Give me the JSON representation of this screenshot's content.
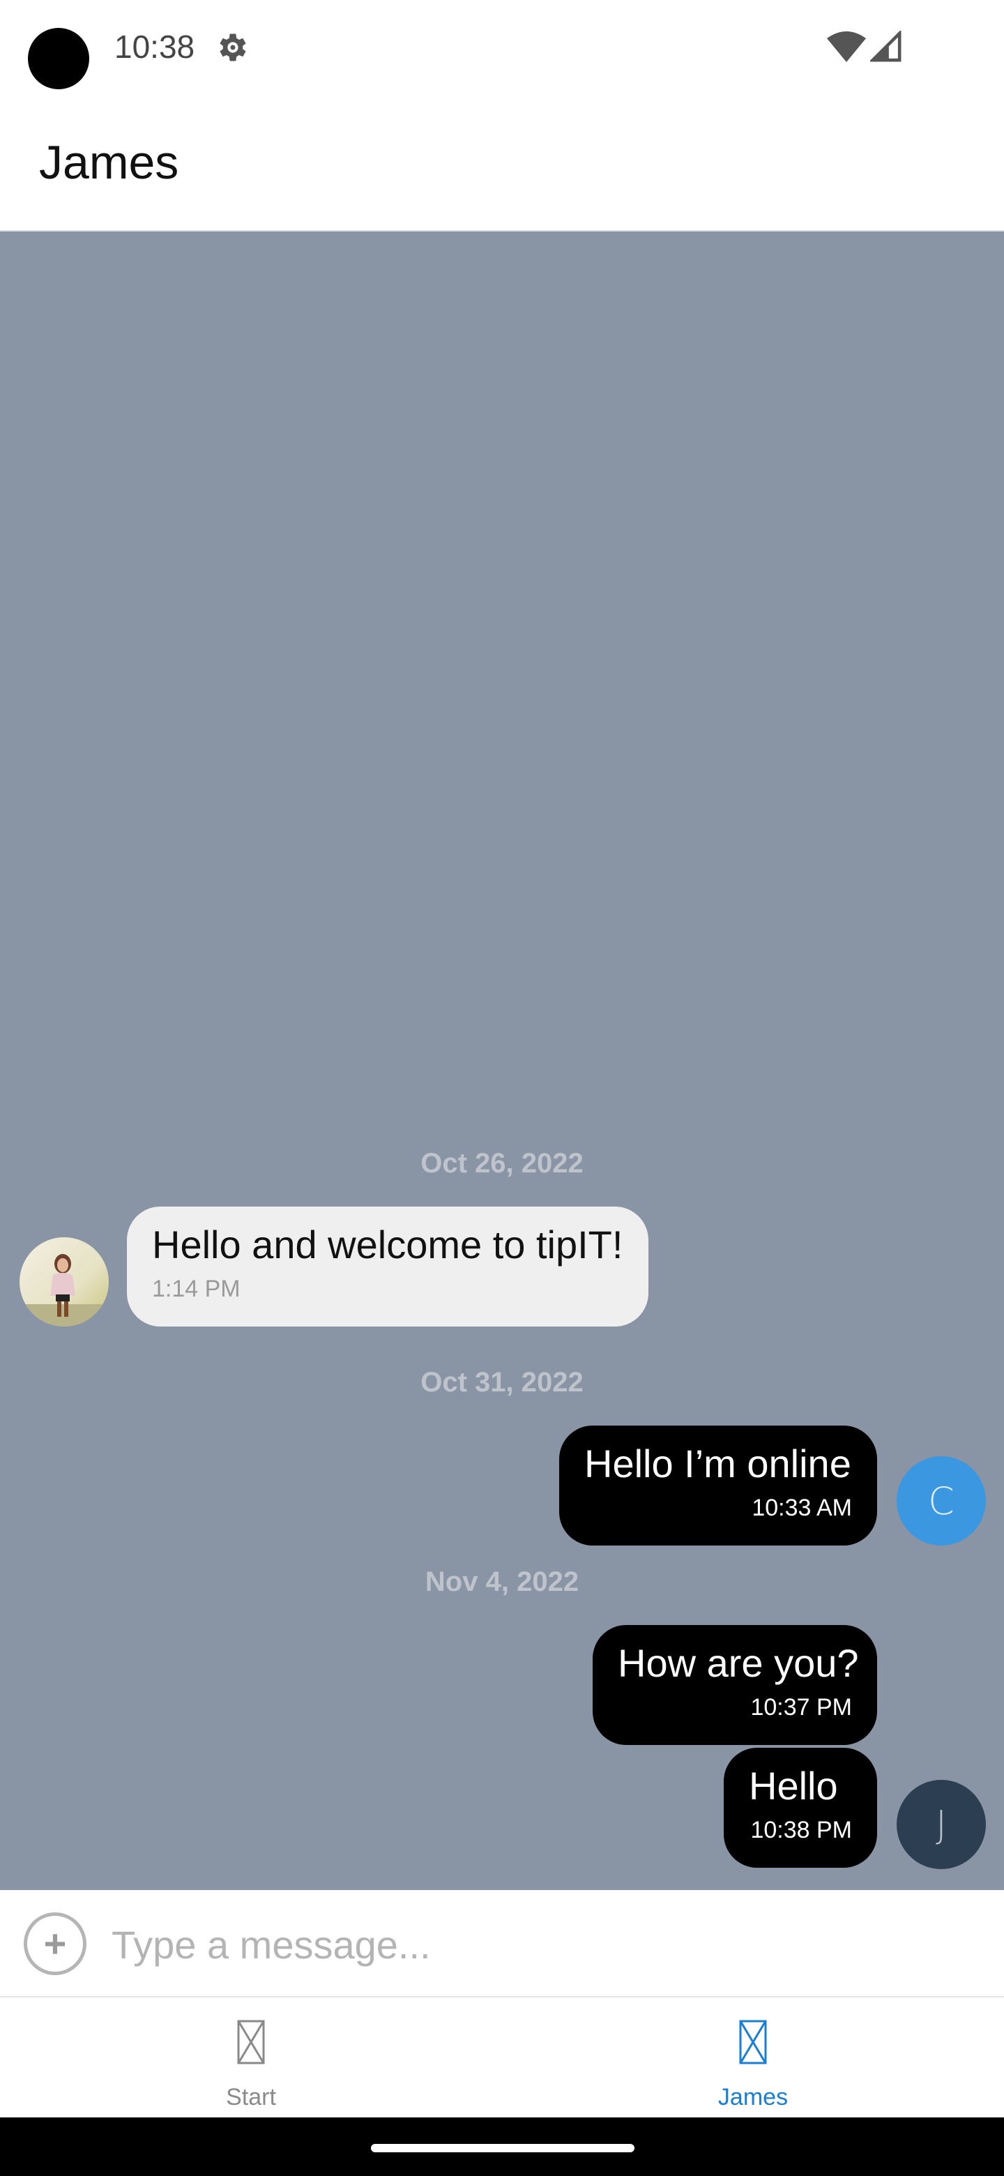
{
  "status_bar": {
    "time": "10:38",
    "icons": [
      "settings-icon",
      "wifi-icon",
      "signal-icon"
    ]
  },
  "header": {
    "title": "James"
  },
  "chat": {
    "background": "#8995a5",
    "date_1": "Oct 26, 2022",
    "msg_1": {
      "text": "Hello and welcome to tipIT!",
      "time": "1:14 PM",
      "direction": "incoming"
    },
    "date_2": "Oct 31, 2022",
    "msg_2": {
      "text": "Hello I’m online",
      "time": "10:33 AM",
      "direction": "outgoing",
      "avatar_letter": "C",
      "avatar_color": "#3a97e0"
    },
    "date_3": "Nov 4, 2022",
    "msg_3": {
      "text": "How are you?",
      "time": "10:37 PM",
      "direction": "outgoing"
    },
    "msg_4": {
      "text": "Hello",
      "time": "10:38 PM",
      "direction": "outgoing",
      "avatar_letter": "J",
      "avatar_color": "#2c3e52"
    }
  },
  "composer": {
    "placeholder": "Type a message...",
    "value": ""
  },
  "tabs": {
    "start": "Start",
    "james": "James",
    "active": "James",
    "active_color": "#1a7fd4"
  }
}
